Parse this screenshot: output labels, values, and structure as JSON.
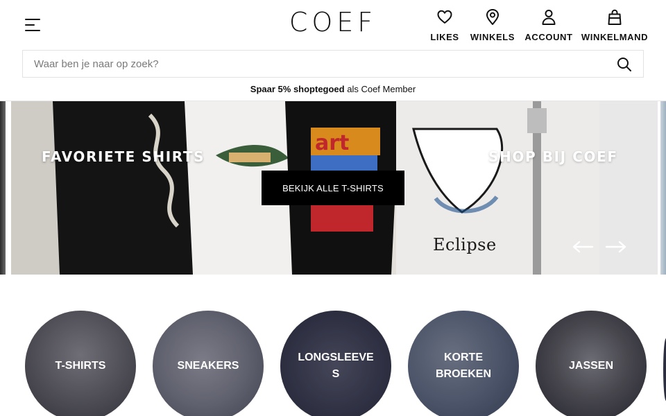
{
  "header": {
    "logo": "COEF",
    "nav": [
      {
        "id": "likes",
        "label": "LIKES",
        "icon": "heart-icon"
      },
      {
        "id": "winkels",
        "label": "WINKELS",
        "icon": "location-pin-icon"
      },
      {
        "id": "account",
        "label": "ACCOUNT",
        "icon": "user-icon"
      },
      {
        "id": "cart",
        "label": "WINKELMAND",
        "icon": "shopping-bag-icon"
      }
    ],
    "search_placeholder": "Waar ben je naar op zoek?",
    "promo": {
      "bold": "Spaar 5% shoptegoed",
      "rest": " als Coef Member"
    }
  },
  "hero": {
    "left_heading": "FAVORIETE SHIRTS",
    "right_heading": "SHOP BIJ COEF",
    "cta": "BEKIJK ALLE T-SHIRTS",
    "shirt_print": "Eclipse"
  },
  "categories": [
    {
      "label": "T-SHIRTS"
    },
    {
      "label": "SNEAKERS"
    },
    {
      "label": "LONGSLEEVES"
    },
    {
      "label": "KORTE BROEKEN"
    },
    {
      "label": "JASSEN"
    }
  ],
  "colors": {
    "accent": "#000000",
    "text": "#111111",
    "overlay": "#1a1c30"
  }
}
